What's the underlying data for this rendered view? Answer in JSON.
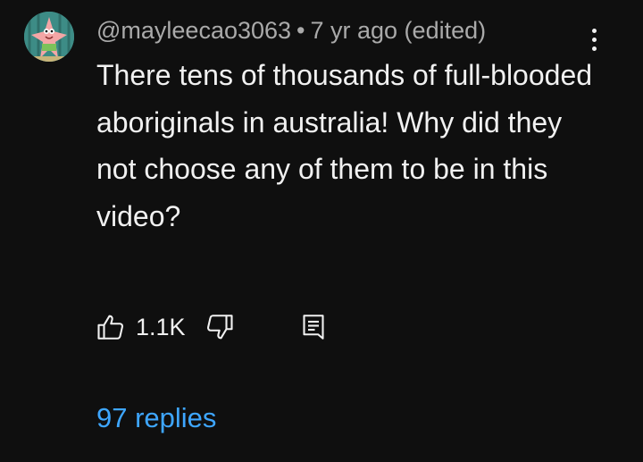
{
  "comment": {
    "author": "@mayleecao3063",
    "separator": "•",
    "timestamp": "7 yr ago (edited)",
    "text": "There tens of thousands of full-blooded aboriginals in australia! Why did they not choose any of them to be in this video?",
    "like_count": "1.1K",
    "replies_label": "97 replies",
    "avatar_icon": "patrick-star-avatar",
    "colors": {
      "background": "#0f0f0f",
      "text": "#f1f1f1",
      "meta": "#aaaaaa",
      "link": "#3ea6ff"
    }
  },
  "icons": {
    "more": "more-vertical-icon",
    "like": "thumbs-up-icon",
    "dislike": "thumbs-down-icon",
    "reply": "reply-icon"
  }
}
